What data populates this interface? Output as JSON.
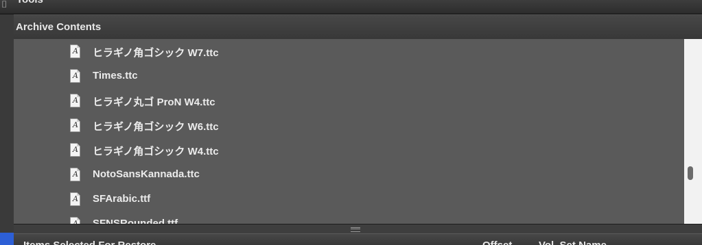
{
  "tools_bar": {
    "label": "Tools"
  },
  "archive_header": {
    "title": "Archive Contents"
  },
  "files": [
    {
      "name": "ヒラギノ角ゴシック W7.ttc",
      "icon": "font-file-icon"
    },
    {
      "name": "Times.ttc",
      "icon": "font-file-icon"
    },
    {
      "name": "ヒラギノ丸ゴ ProN W4.ttc",
      "icon": "font-file-icon"
    },
    {
      "name": "ヒラギノ角ゴシック W6.ttc",
      "icon": "font-file-icon"
    },
    {
      "name": "ヒラギノ角ゴシック W4.ttc",
      "icon": "font-file-icon"
    },
    {
      "name": "NotoSansKannada.ttc",
      "icon": "font-file-icon"
    },
    {
      "name": "SFArabic.ttf",
      "icon": "font-file-icon"
    },
    {
      "name": "SFNSRounded.ttf",
      "icon": "font-file-icon"
    }
  ],
  "file_icon_glyph": "A",
  "restore_header": {
    "title": "Items Selected For Restore",
    "columns": [
      "Offset",
      "Vol. Set Name"
    ]
  },
  "colors": {
    "list_background": "#5a5a5a",
    "header_background": "#3f3f3f",
    "accent_blue": "#2d5fd6"
  }
}
